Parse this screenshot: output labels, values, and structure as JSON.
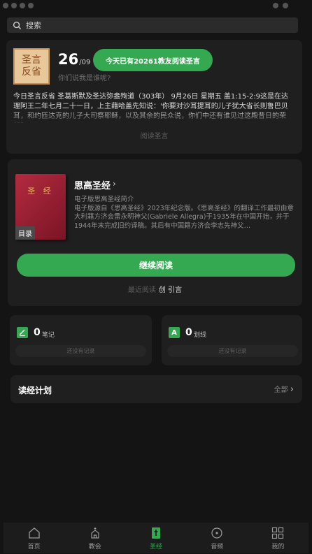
{
  "search": {
    "placeholder": "搜索"
  },
  "daily": {
    "logo_line1": "圣言",
    "logo_line2": "反省",
    "date_day": "26",
    "date_month": "/09",
    "question": "你们说我是谁呢?",
    "readers_badge": "今天已有20261教友阅读圣言",
    "text": "今日圣言反省  圣葛斯默及圣达弥盎殉道（303年）  9月26日 星期五  盖1:15-2:9这是在达理阿王二年七月二十一日，上主藉哈盖先知说：'你要对沙耳提耳的儿子犹大省长则鲁巴贝耳，和约匝达克的儿子大司祭耶稣，以及其余的民众说，你们中还有谁见过这殿昔日的荣华？",
    "read_link": "阅读圣言"
  },
  "book": {
    "cover_title": "圣 经",
    "toc_label": "目录",
    "title": "思高圣经",
    "description": "电子版思高圣经简介\n电子版源自《思高圣经》2023年纪念版。《思高圣经》的翻译工作最初由意大利籍方济会雷永明神父(Gabriele Allegra)于1935年在中国开始，并于1944年末完成旧约译稿。其后有中国籍方济会李志先神父…",
    "continue_label": "继续阅读",
    "recent_label": "最近阅读",
    "recent_value": "创 引言"
  },
  "stats": {
    "notes": {
      "count": "0",
      "label": "笔记",
      "empty": "还没有记录",
      "icon": "note-icon"
    },
    "highlights": {
      "count": "0",
      "label": "划线",
      "empty": "还没有记录",
      "icon": "highlight-icon"
    }
  },
  "plan": {
    "title": "读经计划",
    "all_label": "全部"
  },
  "tabs": [
    {
      "label": "首页",
      "icon": "home-icon"
    },
    {
      "label": "教会",
      "icon": "church-icon"
    },
    {
      "label": "圣经",
      "icon": "bible-icon"
    },
    {
      "label": "音频",
      "icon": "audio-icon"
    },
    {
      "label": "我的",
      "icon": "profile-grid-icon"
    }
  ],
  "colors": {
    "accent": "#35a852",
    "background": "#141414",
    "card": "#1f1f1f"
  }
}
